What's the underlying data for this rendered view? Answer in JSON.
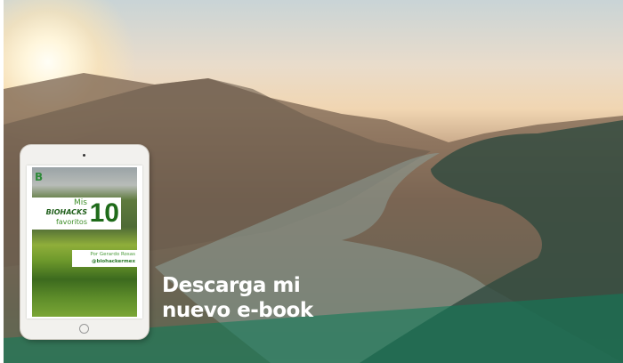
{
  "cover": {
    "logo": "B",
    "mis": "Mis",
    "biohacks": "BIOHACKS",
    "favoritos": "favoritos",
    "number": "10",
    "author": "Por Gerardo Rosas",
    "handle": "@biohackermex"
  },
  "headline": {
    "line1": "Descarga mi",
    "line2": "nuevo e-book"
  },
  "colors": {
    "accent": "#14805d"
  }
}
